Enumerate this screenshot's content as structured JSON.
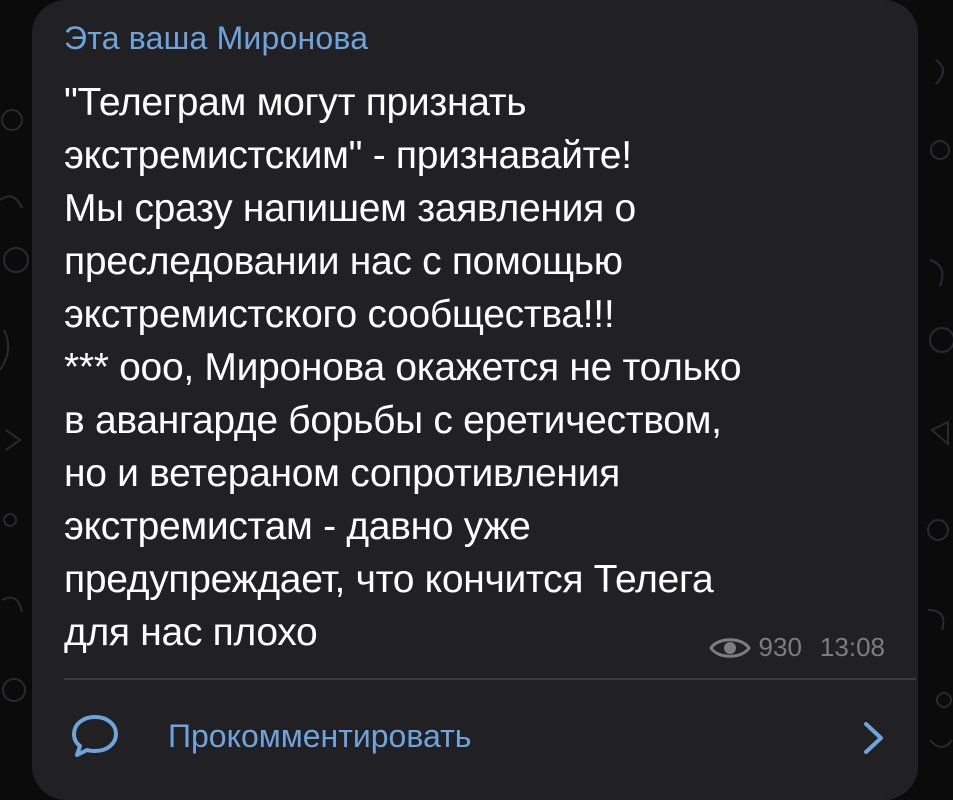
{
  "post": {
    "author": "Эта ваша Миронова",
    "text": "\"Телеграм могут признать\nэкстремистским\" - признавайте!\nМы сразу напишем заявления о\nпреследовании нас с помощью\nэкстремистского сообщества!!!\n*** ооо, Миронова окажется не только\nв авангарде борьбы с еретичеством,\nно и ветераном сопротивления\nэкстремистам - давно уже\nпредупреждает, что кончится Телега\nдля нас плохо",
    "views": "930",
    "time": "13:08",
    "views_icon": "eye-icon"
  },
  "comments": {
    "label": "Прокомментировать",
    "icon": "comment-bubble-icon",
    "chevron_icon": "chevron-right-icon"
  },
  "colors": {
    "background": "#0b0b0c",
    "bubble": "#212123",
    "accent": "#6ea4dd",
    "text": "#ffffff",
    "meta": "#7c7c81"
  }
}
